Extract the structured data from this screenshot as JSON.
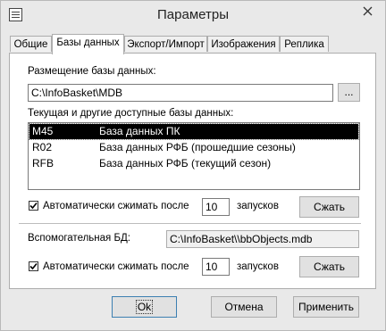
{
  "window": {
    "title": "Параметры"
  },
  "tabs": [
    {
      "label": "Общие"
    },
    {
      "label": "Базы данных"
    },
    {
      "label": "Экспорт/Импорт"
    },
    {
      "label": "Изображения"
    },
    {
      "label": "Реплика"
    }
  ],
  "db": {
    "location_label": "Размещение базы данных:",
    "location_value": "C:\\InfoBasket\\MDB",
    "browse_label": "...",
    "list_label": "Текущая и другие доступные базы данных:",
    "list": [
      {
        "code": "M45",
        "name": "База данных ПК"
      },
      {
        "code": "R02",
        "name": "База данных РФБ (прошедшие сезоны)"
      },
      {
        "code": "RFB",
        "name": "База данных РФБ (текущий сезон)"
      }
    ],
    "auto_compact_label": "Автоматически сжимать после",
    "auto_compact_count": "10",
    "runs_label": "запусков",
    "compact_button": "Сжать",
    "aux_label": "Вспомогательная БД:",
    "aux_value": "C:\\InfoBasket\\\\bbObjects.mdb",
    "aux_auto_compact_label": "Автоматически сжимать после",
    "aux_auto_compact_count": "10",
    "aux_runs_label": "запусков",
    "aux_compact_button": "Сжать"
  },
  "footer": {
    "ok": "Ok",
    "cancel": "Отмена",
    "apply": "Применить"
  }
}
